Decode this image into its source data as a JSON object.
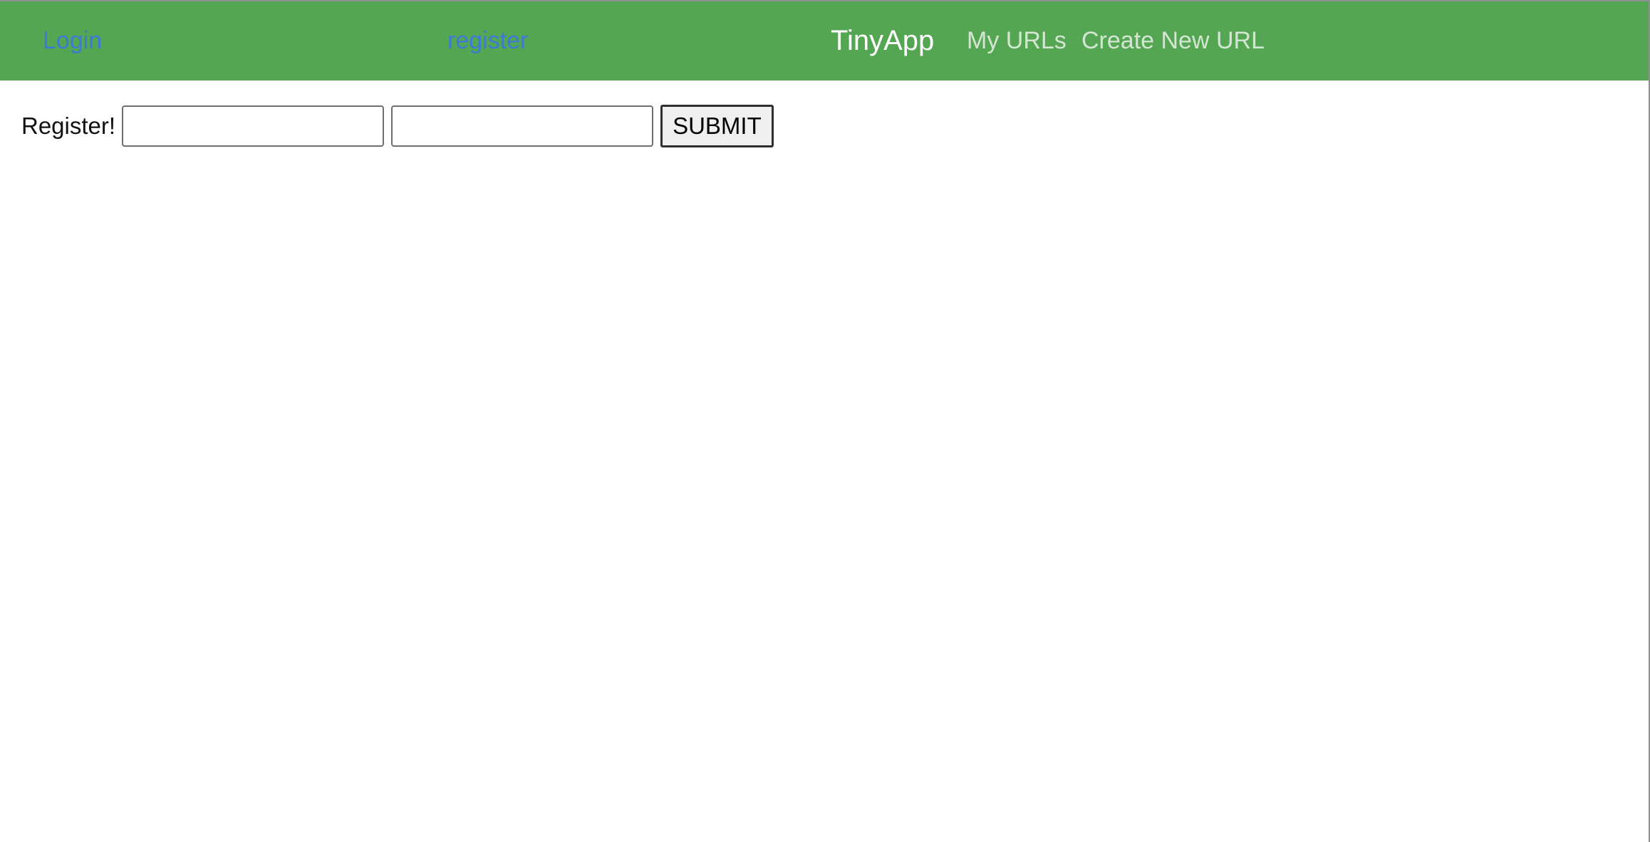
{
  "navbar": {
    "login_label": "Login",
    "register_label": "register",
    "brand": "TinyApp",
    "my_urls_label": "My URLs",
    "create_url_label": "Create New URL",
    "background_color": "#55a653",
    "auth_link_color": "#3b7bd6"
  },
  "register_form": {
    "label": "Register!",
    "email_value": "",
    "password_value": "",
    "submit_label": "SUBMIT"
  }
}
